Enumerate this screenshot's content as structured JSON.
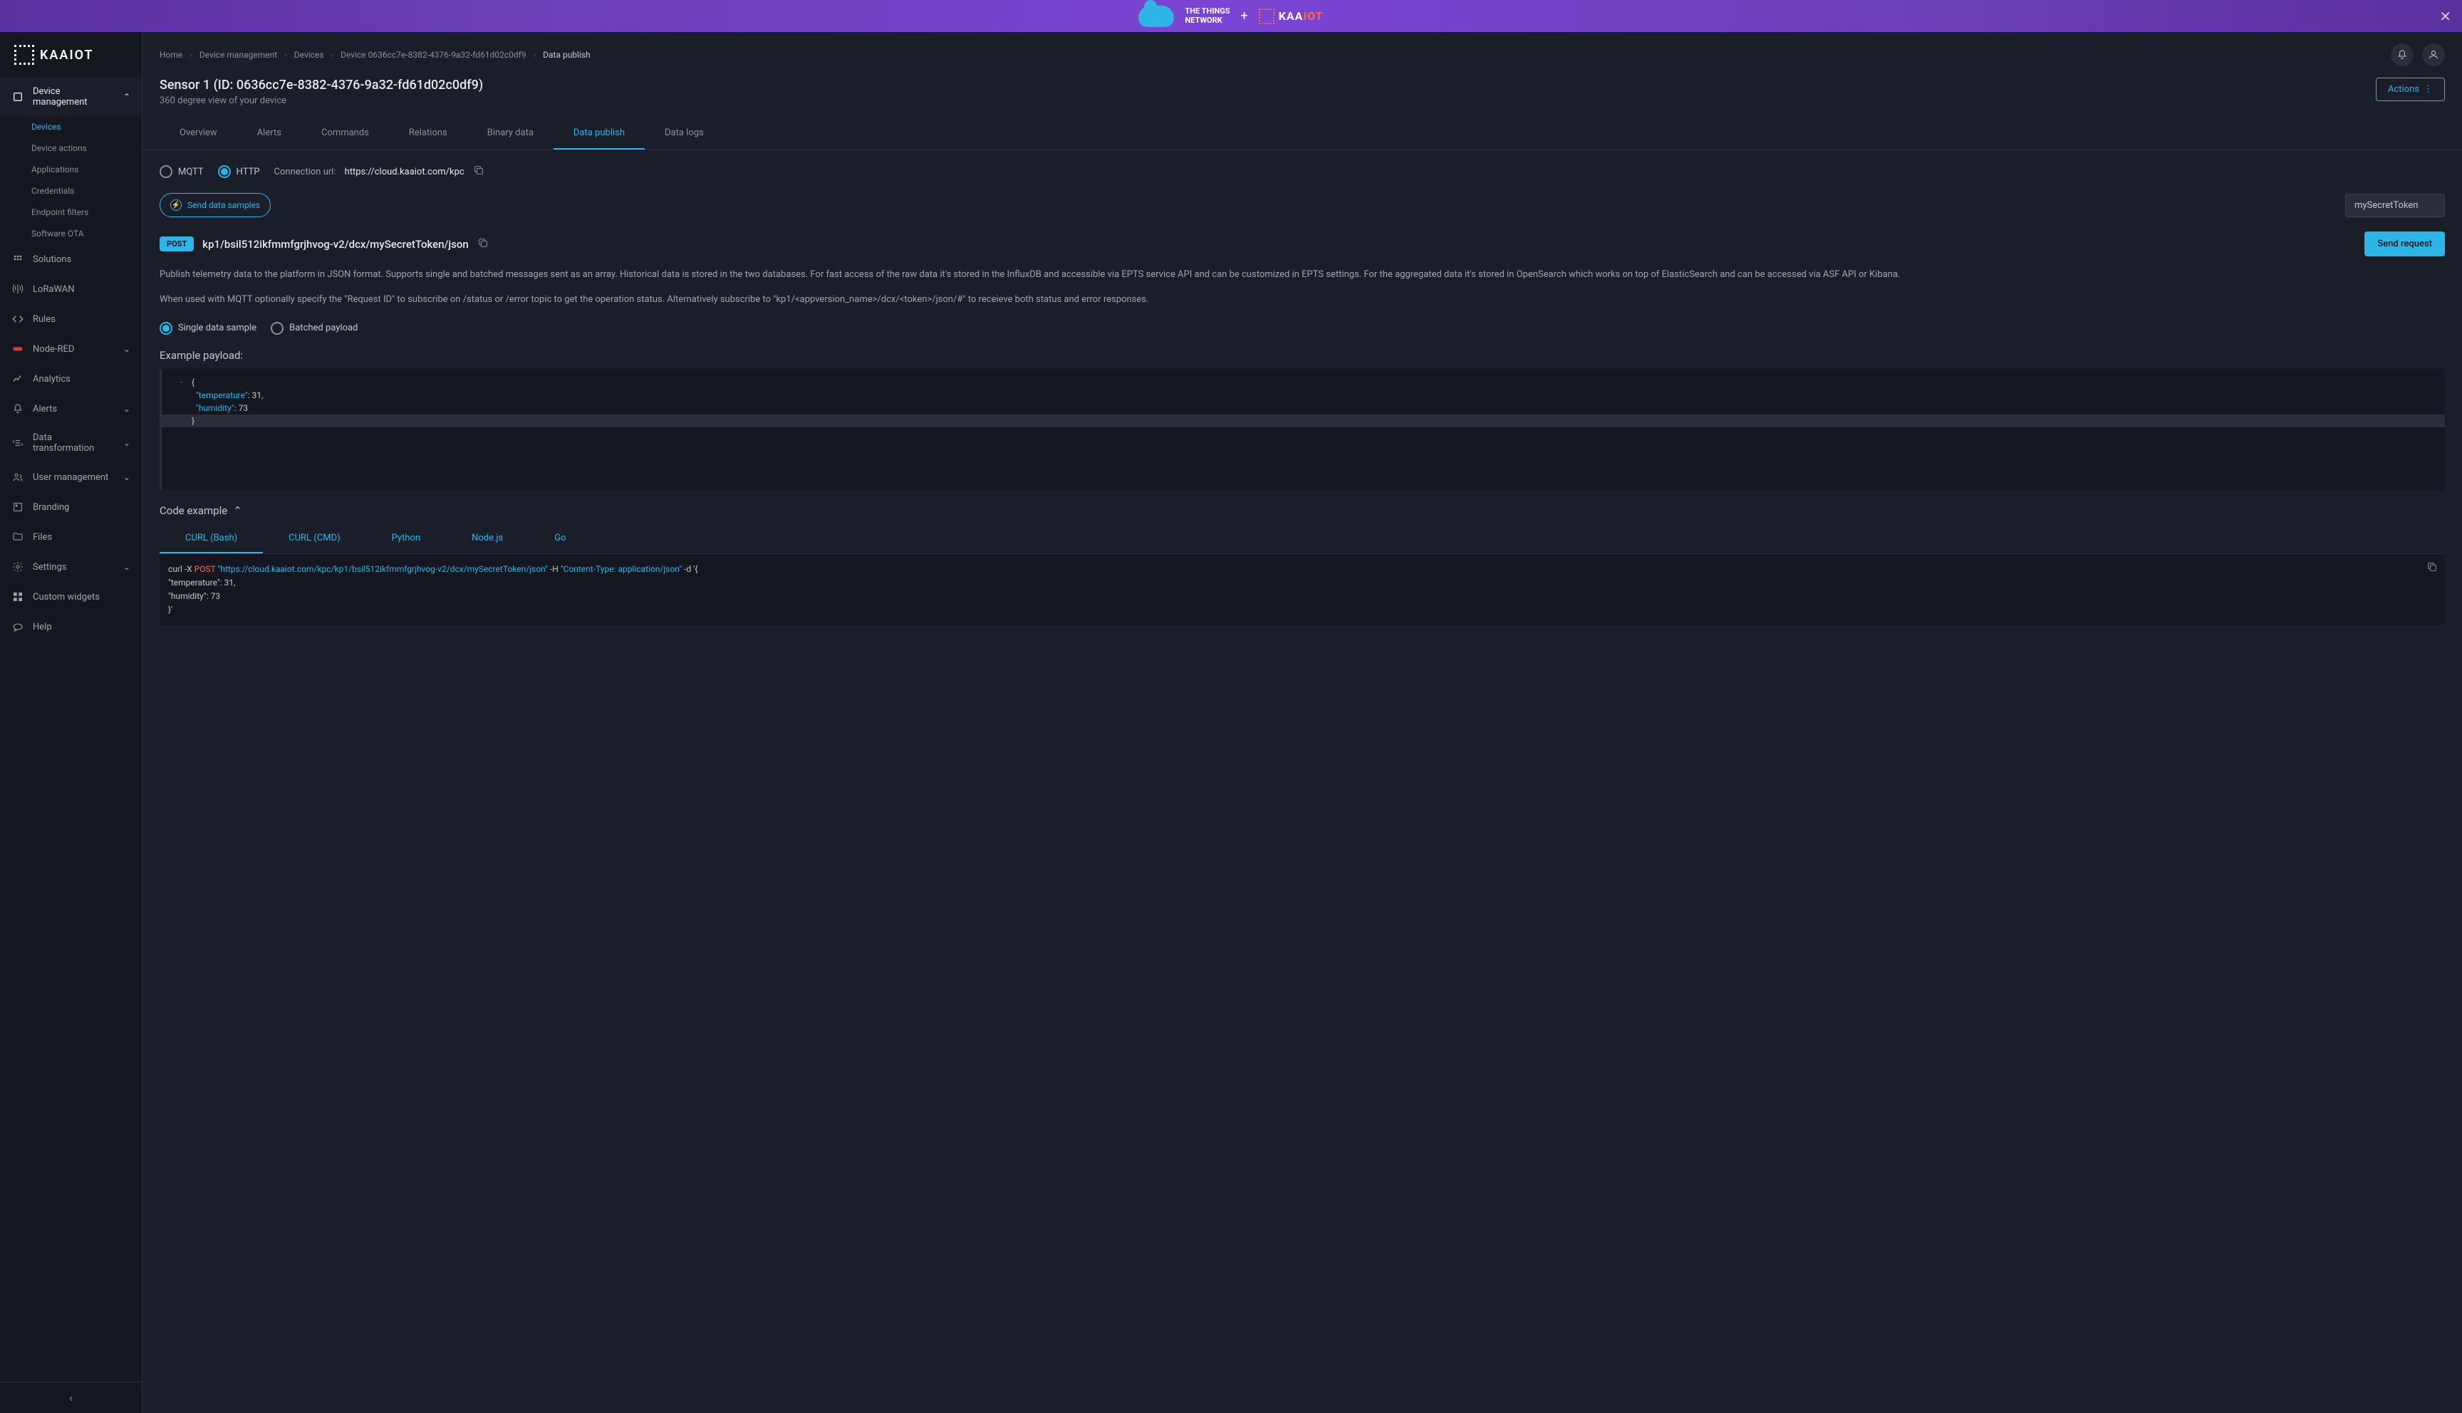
{
  "banner": {
    "ttn_line1": "THE THINGS",
    "ttn_line2": "NETWORK",
    "plus": "+",
    "kaa": "KAA",
    "iot": "IOT"
  },
  "logo": "KAAIOT",
  "sidebar": {
    "device_mgmt": "Device management",
    "devices": "Devices",
    "device_actions": "Device actions",
    "applications": "Applications",
    "credentials": "Credentials",
    "endpoint_filters": "Endpoint filters",
    "software_ota": "Software OTA",
    "solutions": "Solutions",
    "lorawan": "LoRaWAN",
    "rules": "Rules",
    "node_red": "Node-RED",
    "analytics": "Analytics",
    "alerts": "Alerts",
    "data_transformation": "Data transformation",
    "user_mgmt": "User management",
    "branding": "Branding",
    "files": "Files",
    "settings": "Settings",
    "custom_widgets": "Custom widgets",
    "help": "Help"
  },
  "breadcrumb": {
    "home": "Home",
    "dm": "Device management",
    "devices": "Devices",
    "device": "Device 0636cc7e-8382-4376-9a32-fd61d02c0df9",
    "current": "Data publish"
  },
  "header": {
    "title": "Sensor 1 (ID: 0636cc7e-8382-4376-9a32-fd61d02c0df9)",
    "subtitle": "360 degree view of your device",
    "actions": "Actions"
  },
  "tabs": {
    "overview": "Overview",
    "alerts": "Alerts",
    "commands": "Commands",
    "relations": "Relations",
    "binary": "Binary data",
    "publish": "Data publish",
    "logs": "Data logs"
  },
  "protocol": {
    "mqtt": "MQTT",
    "http": "HTTP",
    "conn_label": "Connection url:",
    "conn_value": "https://cloud.kaaiot.com/kpc"
  },
  "send_samples": "Send data samples",
  "endpoint": {
    "method": "POST",
    "path": "kp1/bsil512ikfmmfgrjhvog-v2/dcx/mySecretToken/json",
    "token": "mySecretToken",
    "send": "Send request"
  },
  "desc1": "Publish telemetry data to the platform in JSON format. Supports single and batched messages sent as an array. Historical data is stored in the two databases. For fast access of the raw data it's stored in the InfluxDB and accessible via EPTS service API and can be customized in EPTS settings. For the aggregated data it's stored in OpenSearch which works on top of ElasticSearch and can be accessed via ASF API or Kibana.",
  "desc2": "When used with MQTT optionally specify the \"Request ID\" to subscribe on /status or /error topic to get the operation status. Alternatively subscribe to \"kp1/<appversion_name>/dcx/<token>/json/#\" to receieve both status and error responses.",
  "payload_mode": {
    "single": "Single data sample",
    "batched": "Batched payload"
  },
  "example_label": "Example payload:",
  "payload": {
    "l1": "{",
    "l2_key": "\"temperature\"",
    "l2_sep": ": ",
    "l2_val": "31",
    "l2_comma": ",",
    "l3_key": "\"humidity\"",
    "l3_sep": ": ",
    "l3_val": "73",
    "l4": "}"
  },
  "code_example_label": "Code example",
  "subtabs": {
    "curl_bash": "CURL (Bash)",
    "curl_cmd": "CURL (CMD)",
    "python": "Python",
    "nodejs": "Node.js",
    "go": "Go"
  },
  "curl": {
    "l1_a": "curl ",
    "l1_b": "-X ",
    "l1_c": "POST ",
    "l1_d": "\"https://cloud.kaaiot.com/kpc/kp1/bsil512ikfmmfgrjhvog-v2/dcx/mySecretToken/json\"",
    "l1_e": " -H ",
    "l1_f": "\"Content-Type: application/json\"",
    "l1_g": " -d ",
    "l1_h": "'{",
    "l2": "  \"temperature\": 31,",
    "l3": "  \"humidity\": 73",
    "l4": "}'"
  }
}
